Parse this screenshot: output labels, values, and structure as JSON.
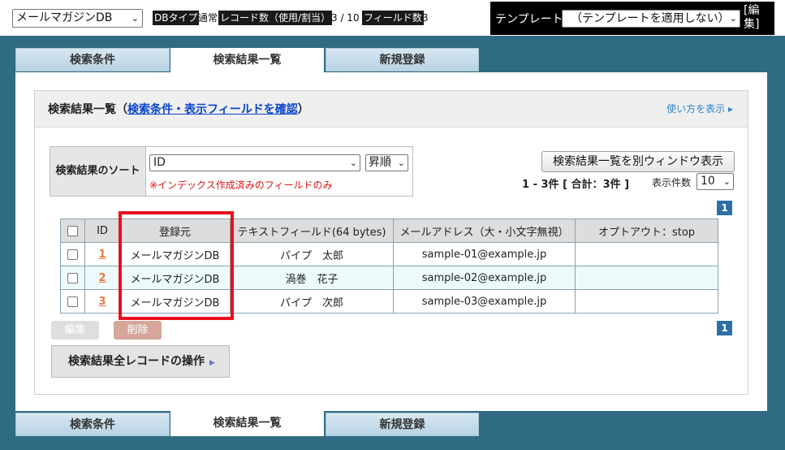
{
  "top": {
    "db_select": "メールマガジンDB",
    "dbtype_label": "DBタイプ",
    "dbtype_value": "通常",
    "records_label": "レコード数（使用/割当）",
    "records_value": "3 / 10",
    "fields_label": "フィールド数",
    "fields_value": "3",
    "template_label": "テンプレート",
    "template_select": "（テンプレートを適用しない）",
    "template_edit": "[編集]"
  },
  "tabs": [
    "検索条件",
    "検索結果一覧",
    "新規登録"
  ],
  "panel": {
    "title_prefix": "検索結果一覧（",
    "title_link": "検索条件・表示フィールドを確認",
    "title_suffix": "）",
    "howto": "使い方を表示 ▸"
  },
  "sort": {
    "label": "検索結果のソート",
    "field": "ID",
    "order": "昇順",
    "note": "※インデックス作成済みのフィールドのみ"
  },
  "window_button": "検索結果一覧を別ウィンドウ表示",
  "count_text": "1 - 3件 [ 合計：3件 ]",
  "perpage_label": "表示件数",
  "perpage_value": "10",
  "page_number": "1",
  "table": {
    "headers": [
      "ID",
      "登録元",
      "テキストフィールド(64 bytes)",
      "メールアドレス（大・小文字無視）",
      "オプトアウト：stop"
    ],
    "rows": [
      {
        "id": "1",
        "source": "メールマガジンDB",
        "text": "パイプ　太郎",
        "email": "sample-01@example.jp",
        "optout": ""
      },
      {
        "id": "2",
        "source": "メールマガジンDB",
        "text": "渦巻　花子",
        "email": "sample-02@example.jp",
        "optout": ""
      },
      {
        "id": "3",
        "source": "メールマガジンDB",
        "text": "パイプ　次郎",
        "email": "sample-03@example.jp",
        "optout": ""
      }
    ]
  },
  "buttons": {
    "edit": "編集",
    "delete": "削除",
    "all_ops": "検索結果全レコードの操作"
  },
  "colors": {
    "teal_bg": "#2f6b82",
    "highlight": "#e8101f",
    "link": "#0a45c9",
    "id_link": "#e27a3b"
  }
}
